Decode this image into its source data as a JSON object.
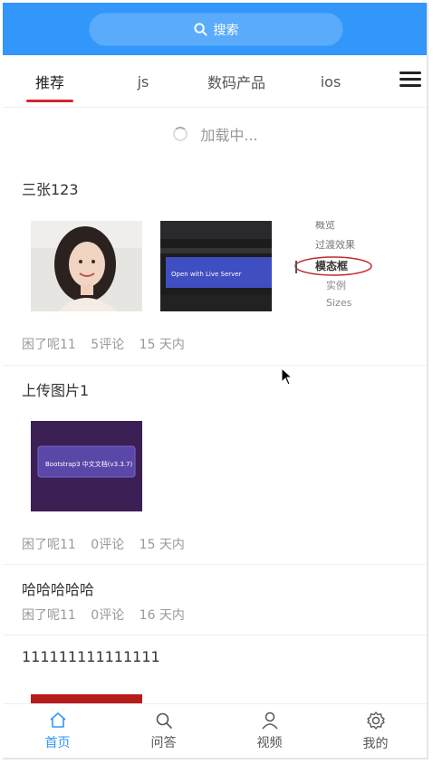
{
  "search": {
    "label": "搜索",
    "icon": "search-icon"
  },
  "tabs": [
    {
      "label": "推荐",
      "active": true
    },
    {
      "label": "js",
      "active": false
    },
    {
      "label": "数码产品",
      "active": false
    },
    {
      "label": "ios",
      "active": false
    }
  ],
  "menu": {
    "icon": "hamburger-menu-icon"
  },
  "loading": {
    "text": "加载中..."
  },
  "articles": [
    {
      "title": "三张123",
      "author": "困了呢11",
      "comments": "5评论",
      "time": "15 天内",
      "images": [
        {
          "name": "portrait-photo"
        },
        {
          "name": "video-screenshot",
          "caption": "Open with Live Server"
        },
        {
          "name": "doc-menu-screenshot",
          "lines": [
            "概览",
            "过渡效果",
            "模态框",
            "实例",
            "Sizes"
          ]
        }
      ]
    },
    {
      "title": "上传图片1",
      "author": "困了呢11",
      "comments": "0评论",
      "time": "15 天内",
      "images": [
        {
          "name": "bootstrap-screenshot",
          "caption": "Bootstrap3 中文文档(v3.3.7)"
        }
      ]
    },
    {
      "title": "哈哈哈哈哈",
      "author": "困了呢11",
      "comments": "0评论",
      "time": "16 天内",
      "images": []
    },
    {
      "title": "111111111111111",
      "images": []
    }
  ],
  "bottom_nav": [
    {
      "label": "首页",
      "icon": "home-icon",
      "active": true
    },
    {
      "label": "问答",
      "icon": "search-icon",
      "active": false
    },
    {
      "label": "视频",
      "icon": "user-icon",
      "active": false
    },
    {
      "label": "我的",
      "icon": "gear-icon",
      "active": false
    }
  ],
  "colors": {
    "primary": "#3296fa",
    "tab_underline": "#d4282c"
  }
}
